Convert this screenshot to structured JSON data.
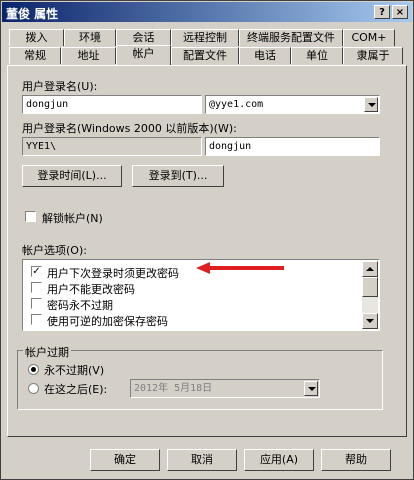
{
  "window": {
    "title": "董俊 属性"
  },
  "tabs_row1": [
    "拨入",
    "环境",
    "会话",
    "远程控制",
    "终端服务配置文件",
    "COM+"
  ],
  "tabs_row2": [
    "常规",
    "地址",
    "帐户",
    "配置文件",
    "电话",
    "单位",
    "隶属于"
  ],
  "account": {
    "logon_name_label": "用户登录名(U):",
    "logon_name": "dongjun",
    "domain_suffix": "@yye1.com",
    "pre2000_label": "用户登录名(Windows 2000 以前版本)(W):",
    "pre2000_domain": "YYE1\\",
    "pre2000_name": "dongjun",
    "logon_hours_btn": "登录时间(L)...",
    "logon_to_btn": "登录到(T)...",
    "unlock_label": "解锁帐户(N)",
    "options_label": "帐户选项(O):",
    "options": [
      {
        "label": "用户下次登录时须更改密码",
        "checked": true
      },
      {
        "label": "用户不能更改密码",
        "checked": false
      },
      {
        "label": "密码永不过期",
        "checked": false
      },
      {
        "label": "使用可逆的加密保存密码",
        "checked": false
      }
    ],
    "expiry_label": "帐户过期",
    "never_label": "永不过期(V)",
    "end_of_label": "在这之后(E):",
    "end_date": "2012年 5月18日"
  },
  "buttons": {
    "ok": "确定",
    "cancel": "取消",
    "apply": "应用(A)",
    "help": "帮助"
  },
  "annotation": {
    "arrow_color": "#e02020"
  }
}
